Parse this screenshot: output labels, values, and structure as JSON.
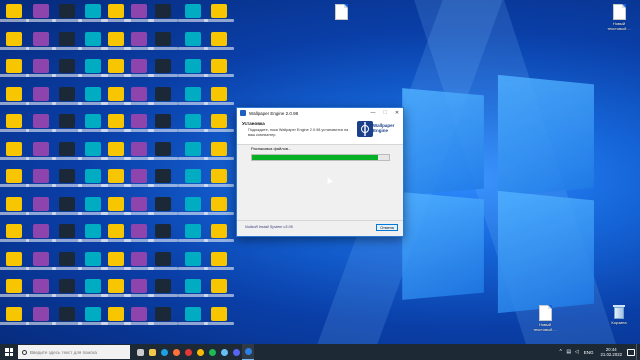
{
  "desktop": {
    "right_icons": [
      {
        "label": "Новый текстовый ..."
      },
      {
        "label": "Новый текстовый ..."
      },
      {
        "label": "Корзина"
      }
    ],
    "icon_colors": [
      "#f7c600",
      "#3a8ee6",
      "#d93025",
      "#0f9d58",
      "#8e44ad",
      "#f57c00",
      "#111111",
      "#ffffff",
      "#1b2838",
      "#5865f2",
      "#e53935",
      "#43a047",
      "#00acc1",
      "#6d4c41",
      "#bdbdbd",
      "#ff7043"
    ]
  },
  "installer": {
    "title": "Wallpaper Engine 2.0.98",
    "heading": "Установка",
    "subheading": "Подождите, пока Wallpaper Engine 2.0.98 установится на ваш компьютер.",
    "brand_text": "Wallpaper Engine",
    "status_text": "Распаковка файлов...",
    "progress": 0.92,
    "progress_color": "#06b025",
    "brandline": "Nullsoft Install System v3.06",
    "cancel_label": "Отмена",
    "minimize_glyph": "—",
    "maximize_glyph": "☐",
    "close_glyph": "✕"
  },
  "taskbar": {
    "search_placeholder": "Введите здесь текст для поиска",
    "apps": [
      {
        "name": "task-view",
        "color": "#cccccc"
      },
      {
        "name": "explorer",
        "color": "#f2c94c"
      },
      {
        "name": "edge",
        "color": "#1fa0e0"
      },
      {
        "name": "firefox",
        "color": "#ff7139"
      },
      {
        "name": "yandex",
        "color": "#e53935"
      },
      {
        "name": "chrome",
        "color": "#fbbc05"
      },
      {
        "name": "spotify",
        "color": "#1db954"
      },
      {
        "name": "steam",
        "color": "#66c0f4"
      },
      {
        "name": "discord",
        "color": "#5865f2"
      },
      {
        "name": "installer",
        "color": "#2d7fe6"
      }
    ],
    "lang": "ENG",
    "time": "20:44",
    "date": "21.02.2022"
  }
}
